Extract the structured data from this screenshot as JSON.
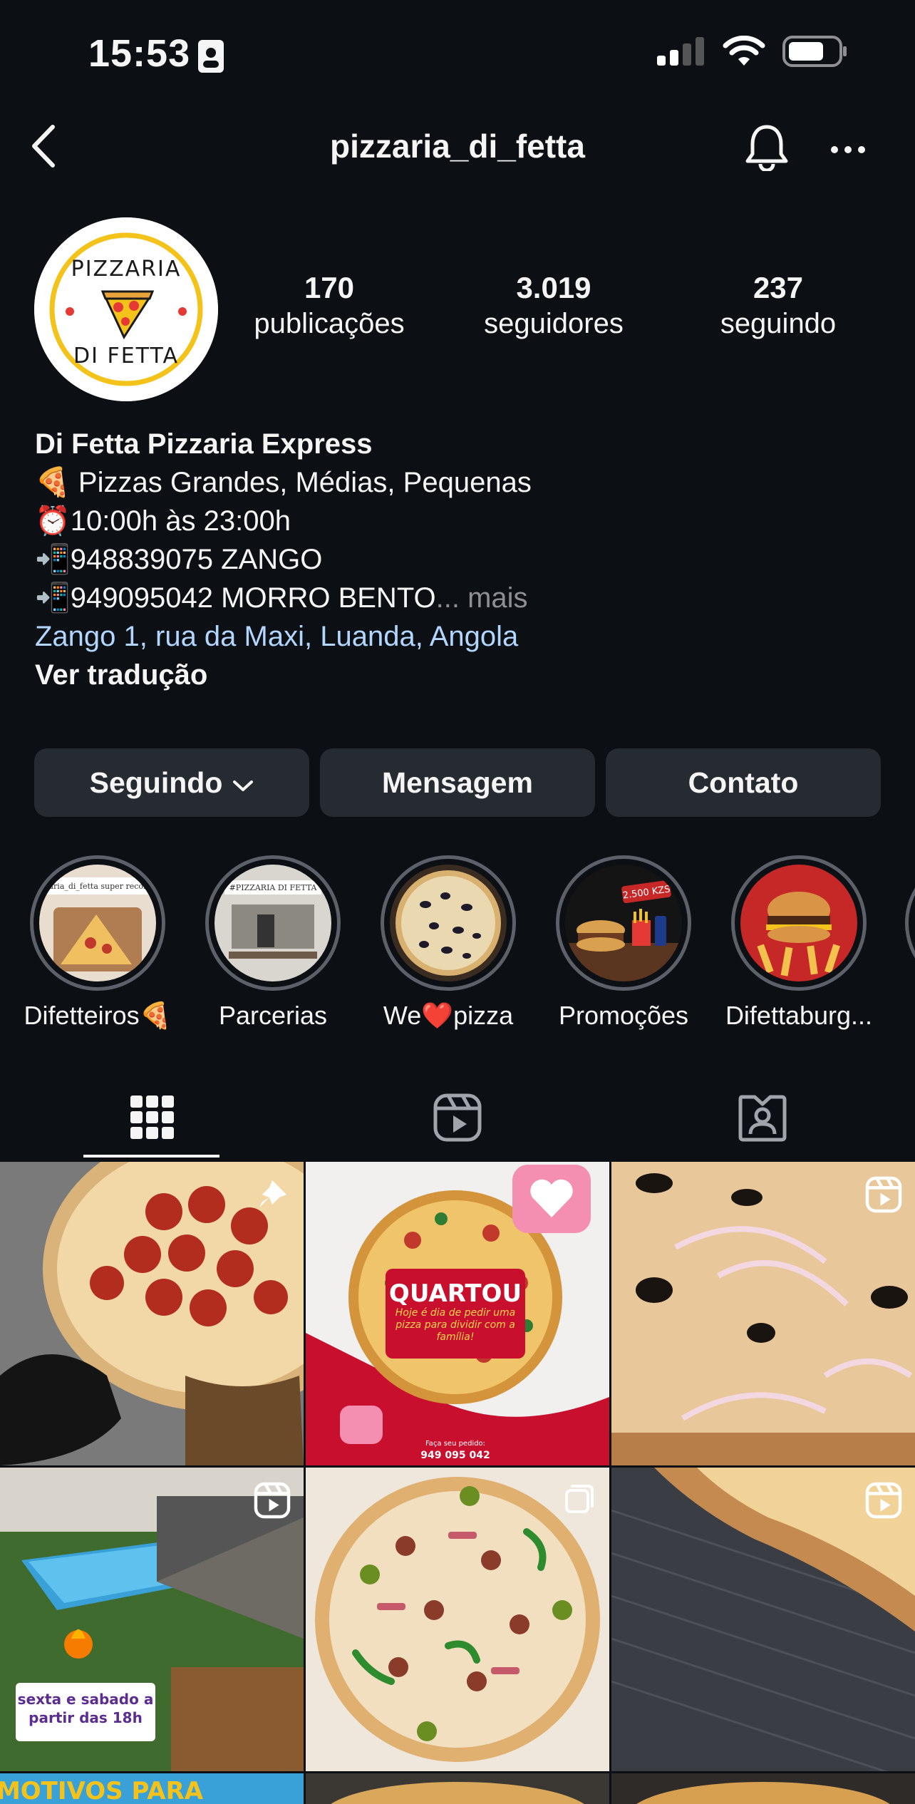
{
  "status_bar": {
    "time": "15:53"
  },
  "header": {
    "title": "pizzaria_di_fetta"
  },
  "profile": {
    "stats": [
      {
        "value": "170",
        "label": "publicações"
      },
      {
        "value": "3.019",
        "label": "seguidores"
      },
      {
        "value": "237",
        "label": "seguindo"
      }
    ],
    "avatar_text_top": "PIZZARIA",
    "avatar_text_bottom": "DI FETTA",
    "name": "Di Fetta Pizzaria Express",
    "bio_lines": [
      "🍕 Pizzas Grandes, Médias, Pequenas",
      "⏰10:00h às 23:00h",
      "📲948839075 ZANGO",
      "📲949095042 MORRO BENTO"
    ],
    "more_label": "... mais",
    "location": "Zango 1, rua da Maxi, Luanda, Angola",
    "translate_label": "Ver tradução"
  },
  "actions": {
    "following": "Seguindo",
    "message": "Mensagem",
    "contact": "Contato"
  },
  "highlights": [
    {
      "label": "Difetteiros🍕"
    },
    {
      "label": "Parcerias"
    },
    {
      "label": "We❤️pizza"
    },
    {
      "label": "Promoções"
    },
    {
      "label": "Difettaburg..."
    }
  ],
  "highlight_texts": {
    "h1_caption": "@pizzaria_di_fetta super recomendo",
    "h2_caption": "#PIZZARIA DI FETTA",
    "promo_price": "2.500 KZS"
  },
  "tabs": [
    {
      "icon": "grid-icon",
      "active": true
    },
    {
      "icon": "reels-icon",
      "active": false
    },
    {
      "icon": "tagged-icon",
      "active": false
    }
  ],
  "posts": {
    "p2_title": "QUARTOU",
    "p2_sub": "Hoje é dia de pedir uma pizza para dividir com a família!",
    "p2_footer_label": "Faça seu pedido:",
    "p2_footer_phone": "949 095 042",
    "p4_caption": "sexta e sabado a partir das 18h",
    "p7_caption": "MOTIVOS PARA"
  },
  "colors": {
    "background": "#0c0f14",
    "button": "#262a31",
    "link": "#b3d6ff",
    "muted": "#8e8e93"
  }
}
